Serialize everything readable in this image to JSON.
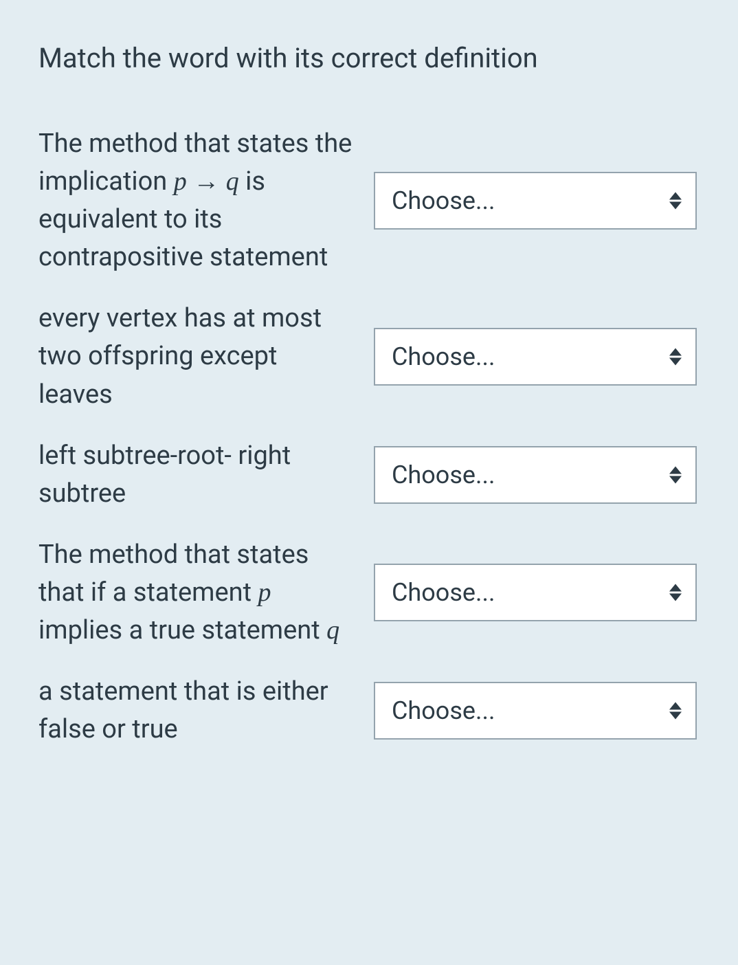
{
  "question": {
    "title": "Match the word with its correct definition",
    "rows": [
      {
        "definition_segments": [
          {
            "text": "The method that states the implication ",
            "class": "seg"
          },
          {
            "text": "p",
            "class": "math"
          },
          {
            "text": " → ",
            "class": "math arrow"
          },
          {
            "text": "q",
            "class": "math"
          },
          {
            "text": " is equivalent to its contrapositive statement",
            "class": "seg"
          }
        ],
        "select_placeholder": "Choose..."
      },
      {
        "definition_segments": [
          {
            "text": "every vertex has at most two offspring except leaves",
            "class": "seg"
          }
        ],
        "select_placeholder": "Choose..."
      },
      {
        "definition_segments": [
          {
            "text": "left subtree-root- right subtree",
            "class": "seg"
          }
        ],
        "select_placeholder": "Choose..."
      },
      {
        "definition_segments": [
          {
            "text": "The method that states that if a statement ",
            "class": "seg"
          },
          {
            "text": "p",
            "class": "math"
          },
          {
            "text": " implies a true statement ",
            "class": "seg"
          },
          {
            "text": "q",
            "class": "math"
          }
        ],
        "select_placeholder": "Choose..."
      },
      {
        "definition_segments": [
          {
            "text": "a statement  that is either  false or true",
            "class": "seg"
          }
        ],
        "select_placeholder": "Choose..."
      }
    ]
  }
}
